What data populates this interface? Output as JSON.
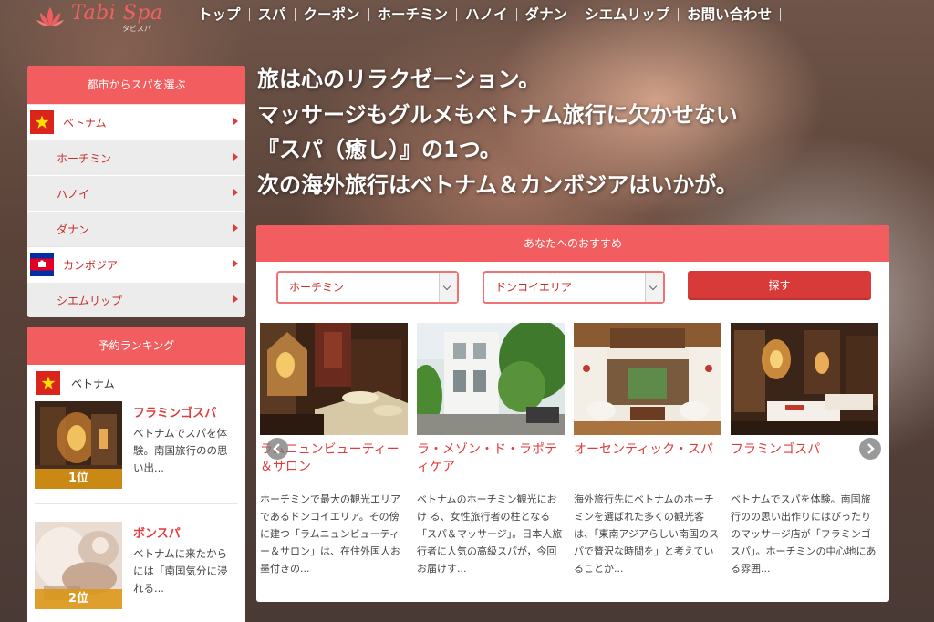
{
  "header": {
    "logo_text": "Tabi Spa",
    "logo_sub": "タビスパ",
    "nav": [
      "トップ",
      "スパ",
      "クーポン",
      "ホーチミン",
      "ハノイ",
      "ダナン",
      "シエムリップ",
      "お問い合わせ"
    ]
  },
  "hero": {
    "lines": [
      "旅は心のリラクゼーション。",
      "マッサージもグルメもベトナム旅行に欠かせない",
      "『スパ（癒し）』の1つ。",
      "次の海外旅行はベトナム＆カンボジアはいかが。"
    ]
  },
  "city_panel": {
    "title": "都市からスパを選ぶ",
    "vietnam": "ベトナム",
    "vn_cities": [
      "ホーチミン",
      "ハノイ",
      "ダナン"
    ],
    "cambodia": "カンボジア",
    "kh_cities": [
      "シエムリップ"
    ]
  },
  "ranking": {
    "title": "予約ランキング",
    "country": "ベトナム",
    "items": [
      {
        "name": "フラミンゴスパ",
        "desc": "ベトナムでスパを体験。南国旅行のの思い出...",
        "rank": "1位"
      },
      {
        "name": "ボンスパ",
        "desc": "ベトナムに来たからには「南国気分に浸れる...",
        "rank": "2位"
      }
    ]
  },
  "recommend": {
    "title": "あなたへのおすすめ",
    "area_select": "ホーチミン",
    "district_select": "ドンコイエリア",
    "search_label": "探す",
    "cards": [
      {
        "title": "ラムニュンビューティー＆サロン",
        "desc": "ホーチミンで最大の観光エリアであるドンコイエリア。その傍に建つ「ラムニュンビューティー＆サロン」は、在住外国人お墨付きの..."
      },
      {
        "title": "ラ・メゾン・ド・ラポティケア",
        "desc": "ベトナムのホーチミン観光におけ る、女性旅行者の柱となる「スパ＆マッサージ」。日本人旅行者に人気の高級スパが，今回お届けす..."
      },
      {
        "title": "オーセンティック・スパ",
        "desc": "海外旅行先にベトナムのホーチミンを選ばれた多くの観光客は、「東南アジアらしい南国のスパで贅沢な時間を」と考えていることか..."
      },
      {
        "title": "フラミンゴスパ",
        "desc": "ベトナムでスパを体験。南国旅行のの思い出作りにはぴったりのマッサージ店が「フラミンゴスパ」。ホーチミンの中心地にある雰囲..."
      }
    ]
  },
  "colors": {
    "accent": "#f25e5f",
    "link": "#e23b3b",
    "rank_badge": "#dc9614"
  },
  "icons": [
    "lotus-logo-icon",
    "vietnam-flag-icon",
    "cambodia-flag-icon",
    "chevron-left-icon",
    "chevron-right-icon"
  ]
}
